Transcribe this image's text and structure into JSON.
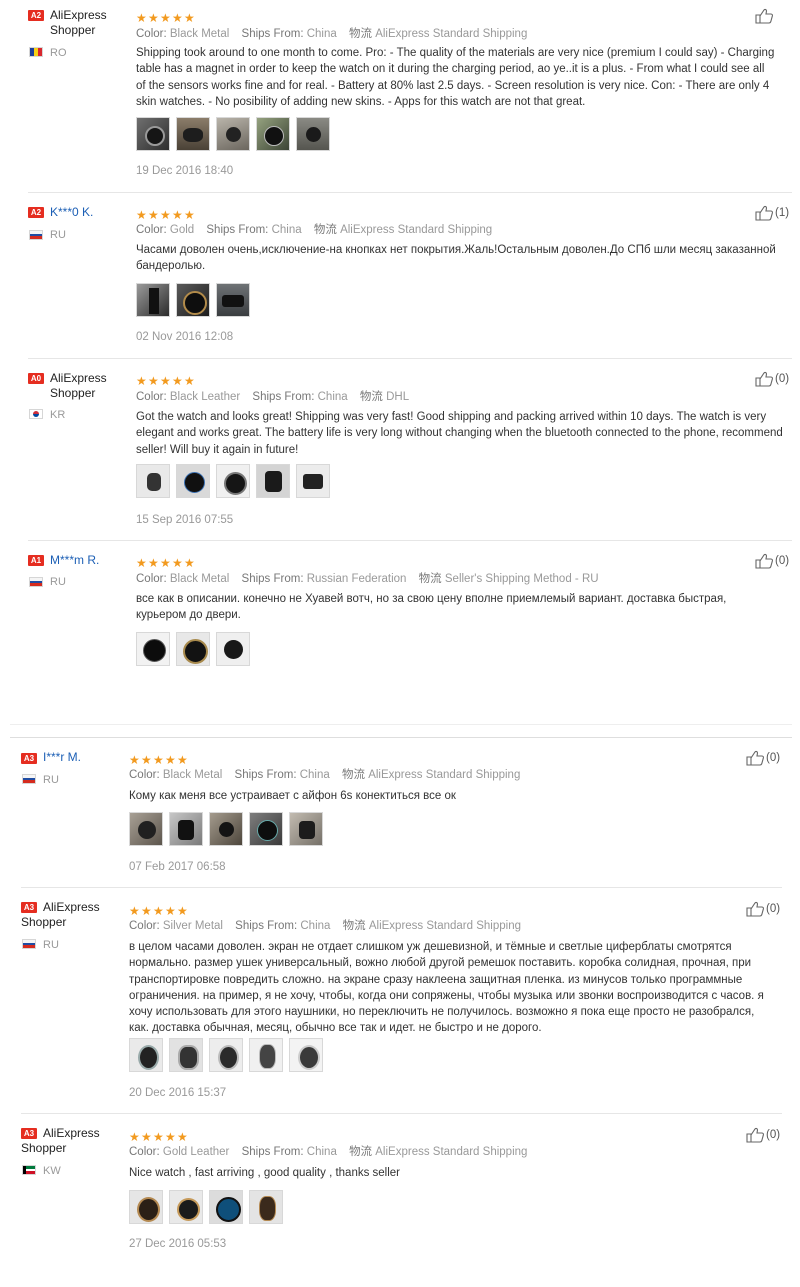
{
  "colors": {
    "badge": "#e52d20",
    "star": "#f29a1f",
    "link": "#1c5fb5"
  },
  "reviews": [
    {
      "level": "A2",
      "user": "AliExpress Shopper",
      "user_is_link": false,
      "country": "RO",
      "flag": "ro",
      "stars": 5,
      "color_label": "Color:",
      "color": "Black Metal",
      "ships_label": "Ships From:",
      "ships_from": "China",
      "logistics_label": "物流",
      "logistics": "AliExpress Standard Shipping",
      "text": "Shipping took around to one month to come. Pro: - The quality of the materials are very nice (premium I could say) - Charging table has a magnet in order to keep the watch on it during the charging period, ao ye..it is a plus. - From what I could see all of the sensors works fine and for real. - Battery at 80% last 2.5 days. - Screen resolution is very nice. Con: - There are only 4 skin watches. - No posibility of adding new skins. - Apps for this watch are not that great.",
      "photos": 5,
      "date": "19 Dec 2016 18:40",
      "helpful": ""
    },
    {
      "level": "A2",
      "user": "K***0 K.",
      "user_is_link": true,
      "country": "RU",
      "flag": "ru",
      "stars": 5,
      "color_label": "Color:",
      "color": "Gold",
      "ships_label": "Ships From:",
      "ships_from": "China",
      "logistics_label": "物流",
      "logistics": "AliExpress Standard Shipping",
      "text": "Часами доволен очень,исключение-на кнопках нет покрытия.Жаль!Остальным доволен.До СПб шли месяц заказанной бандеролью.",
      "photos": 3,
      "date": "02 Nov 2016 12:08",
      "helpful": "(1)"
    },
    {
      "level": "A0",
      "user": "AliExpress Shopper",
      "user_is_link": false,
      "country": "KR",
      "flag": "kr",
      "stars": 5,
      "color_label": "Color:",
      "color": "Black Leather",
      "ships_label": "Ships From:",
      "ships_from": "China",
      "logistics_label": "物流",
      "logistics": "DHL",
      "text": "Got the watch and looks great! Shipping was very fast! Good shipping and packing arrived within 10 days. The watch is very elegant and works great. The battery life is very long without changing when the bluetooth connected to the phone, recommend seller! Will buy it again in future!",
      "photos": 5,
      "date": "15 Sep 2016 07:55",
      "helpful": "(0)"
    },
    {
      "level": "A1",
      "user": "M***m R.",
      "user_is_link": true,
      "country": "RU",
      "flag": "ru",
      "stars": 5,
      "color_label": "Color:",
      "color": "Black Metal",
      "ships_label": "Ships From:",
      "ships_from": "Russian Federation",
      "logistics_label": "物流",
      "logistics": "Seller's Shipping Method - RU",
      "text": "все как в описании. конечно не Хуавей вотч, но за свою цену вполне приемлемый вариант. доставка быстрая, курьером до двери.",
      "photos": 3,
      "date": "",
      "helpful": "(0)"
    },
    {
      "level": "A3",
      "user": "I***r M.",
      "user_is_link": true,
      "country": "RU",
      "flag": "ru",
      "stars": 5,
      "color_label": "Color:",
      "color": "Black Metal",
      "ships_label": "Ships From:",
      "ships_from": "China",
      "logistics_label": "物流",
      "logistics": "AliExpress Standard Shipping",
      "text": "Кому как меня все устраивает с айфон 6s конектиться все ок",
      "photos": 5,
      "date": "07 Feb 2017 06:58",
      "helpful": "(0)"
    },
    {
      "level": "A3",
      "user": "AliExpress Shopper",
      "user_is_link": false,
      "country": "RU",
      "flag": "ru",
      "stars": 5,
      "color_label": "Color:",
      "color": "Silver Metal",
      "ships_label": "Ships From:",
      "ships_from": "China",
      "logistics_label": "物流",
      "logistics": "AliExpress Standard Shipping",
      "text": "в целом часами доволен. экран не отдает слишком уж дешевизной, и тёмные и светлые циферблаты смотрятся нормально. размер ушек универсальный, вожно любой другой ремешок поставить. коробка солидная, прочная, при транспортировке повредить сложно. на экране сразу наклеена защитная пленка. из минусов только программные ограничения. на пример, я не хочу, чтобы, когда они сопряжены, чтобы музыка или звонки воспроизводится с часов. я хочу использовать для этого наушники, но переключить не получилось. возможно я пока еще просто не разобрался, как. доставка обычная, месяц, обычно все так и идет. не быстро и не дорого.",
      "photos": 5,
      "date": "20 Dec 2016 15:37",
      "helpful": "(0)"
    },
    {
      "level": "A3",
      "user": "AliExpress Shopper",
      "user_is_link": false,
      "country": "KW",
      "flag": "kw",
      "stars": 5,
      "color_label": "Color:",
      "color": "Gold Leather",
      "ships_label": "Ships From:",
      "ships_from": "China",
      "logistics_label": "物流",
      "logistics": "AliExpress Standard Shipping",
      "text": "Nice watch , fast arriving , good quality , thanks seller",
      "photos": 4,
      "date": "27 Dec 2016 05:53",
      "helpful": "(0)"
    }
  ]
}
